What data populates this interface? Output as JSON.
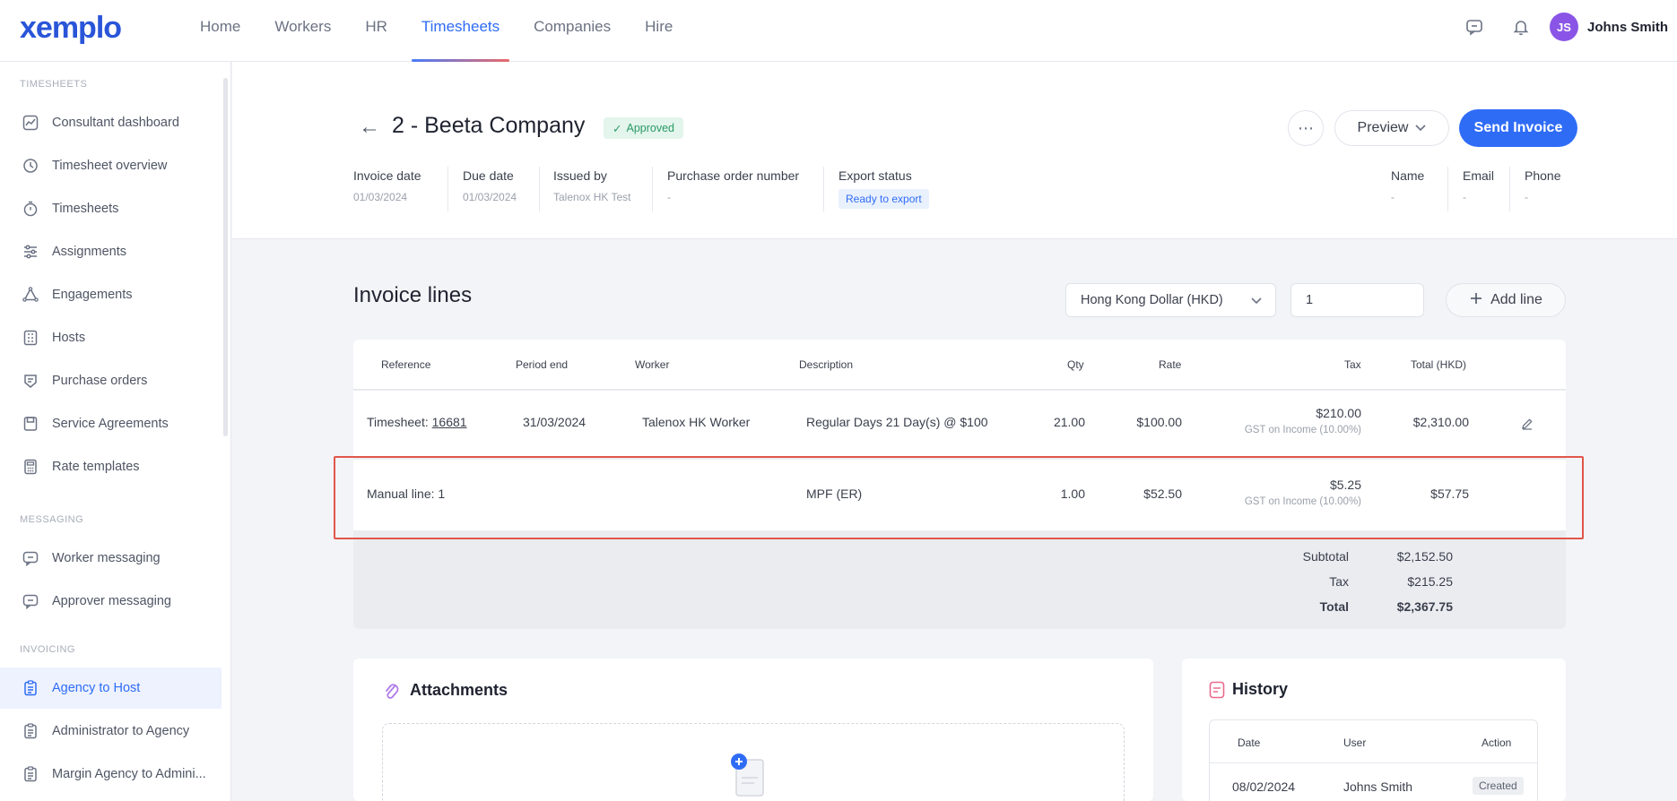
{
  "app": {
    "logo_text": "xemplo",
    "nav": [
      "Home",
      "Workers",
      "HR",
      "Timesheets",
      "Companies",
      "Hire"
    ],
    "active_nav": "Timesheets",
    "user": {
      "initials": "JS",
      "name": "Johns Smith"
    },
    "icons": {
      "messages": "chat-icon",
      "notifications": "bell-icon"
    }
  },
  "sidebar": {
    "sections": [
      {
        "title": "TIMESHEETS",
        "items": [
          "Consultant dashboard",
          "Timesheet overview",
          "Timesheets",
          "Assignments",
          "Engagements",
          "Hosts",
          "Purchase orders",
          "Service Agreements",
          "Rate templates"
        ]
      },
      {
        "title": "MESSAGING",
        "items": [
          "Worker messaging",
          "Approver messaging"
        ]
      },
      {
        "title": "INVOICING",
        "items": [
          "Agency to Host",
          "Administrator to Agency",
          "Margin Agency to Admini..."
        ]
      }
    ],
    "active_item": "Agency to Host"
  },
  "invoice": {
    "title": "2 - Beeta Company",
    "status": "Approved",
    "buttons": {
      "preview": "Preview",
      "send": "Send Invoice",
      "more": "⋯"
    },
    "meta": [
      {
        "label": "Invoice date",
        "value": "01/03/2024"
      },
      {
        "label": "Due date",
        "value": "01/03/2024"
      },
      {
        "label": "Issued by",
        "value": "Talenox HK Test"
      },
      {
        "label": "Purchase order number",
        "value": "-"
      },
      {
        "label": "Export status",
        "value": "Ready to export"
      }
    ],
    "contact": [
      {
        "label": "Name",
        "value": "-"
      },
      {
        "label": "Email",
        "value": "-"
      },
      {
        "label": "Phone",
        "value": "-"
      }
    ]
  },
  "lines": {
    "title": "Invoice lines",
    "currency": "Hong Kong Dollar (HKD)",
    "quantity_input": "1",
    "add_line": "Add line",
    "columns": [
      "Reference",
      "Period end",
      "Worker",
      "Description",
      "Qty",
      "Rate",
      "Tax",
      "Total (HKD)"
    ],
    "rows": [
      {
        "ref_prefix": "Timesheet: ",
        "ref_link": "16681",
        "period_end": "31/03/2024",
        "worker": "Talenox HK Worker",
        "description": "Regular Days 21 Day(s) @ $100",
        "qty": "21.00",
        "rate": "$100.00",
        "tax": "$210.00",
        "tax_note": "GST on Income (10.00%)",
        "total": "$2,310.00"
      },
      {
        "ref_prefix": "Manual line: 1",
        "ref_link": "",
        "period_end": "",
        "worker": "",
        "description": "MPF (ER)",
        "qty": "1.00",
        "rate": "$52.50",
        "tax": "$5.25",
        "tax_note": "GST on Income (10.00%)",
        "total": "$57.75"
      }
    ],
    "totals": [
      {
        "label": "Subtotal",
        "value": "$2,152.50"
      },
      {
        "label": "Tax",
        "value": "$215.25"
      },
      {
        "label": "Total",
        "value": "$2,367.75"
      }
    ]
  },
  "attachments": {
    "title": "Attachments"
  },
  "history": {
    "title": "History",
    "columns": [
      "Date",
      "User",
      "Action"
    ],
    "rows": [
      {
        "date": "08/02/2024",
        "user": "Johns Smith",
        "action": "Created"
      }
    ]
  }
}
